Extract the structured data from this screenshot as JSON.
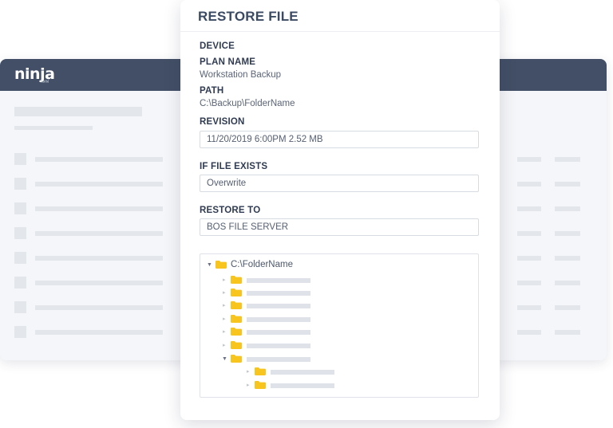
{
  "app": {
    "logo_text": "ninja",
    "logo_subtext": "RMM"
  },
  "dialog": {
    "title": "RESTORE FILE",
    "device_label": "DEVICE",
    "plan_name_label": "PLAN NAME",
    "plan_name_value": "Workstation Backup",
    "path_label": "PATH",
    "path_value": "C:\\Backup\\FolderName",
    "revision_label": "REVISION",
    "revision_value": "11/20/2019 6:00PM 2.52 MB",
    "if_file_exists_label": "IF FILE EXISTS",
    "if_file_exists_value": "Overwrite",
    "restore_to_label": "RESTORE TO",
    "restore_to_value": "BOS FILE SERVER",
    "tree": {
      "root_label": "C:\\FolderName",
      "root_icon": "folder-icon",
      "expand_icon": "caret-icon"
    }
  },
  "colors": {
    "header": "#424f66",
    "title_text": "#3b4a63",
    "folder": "#f7c51e",
    "placeholder": "#dfe2e8"
  }
}
